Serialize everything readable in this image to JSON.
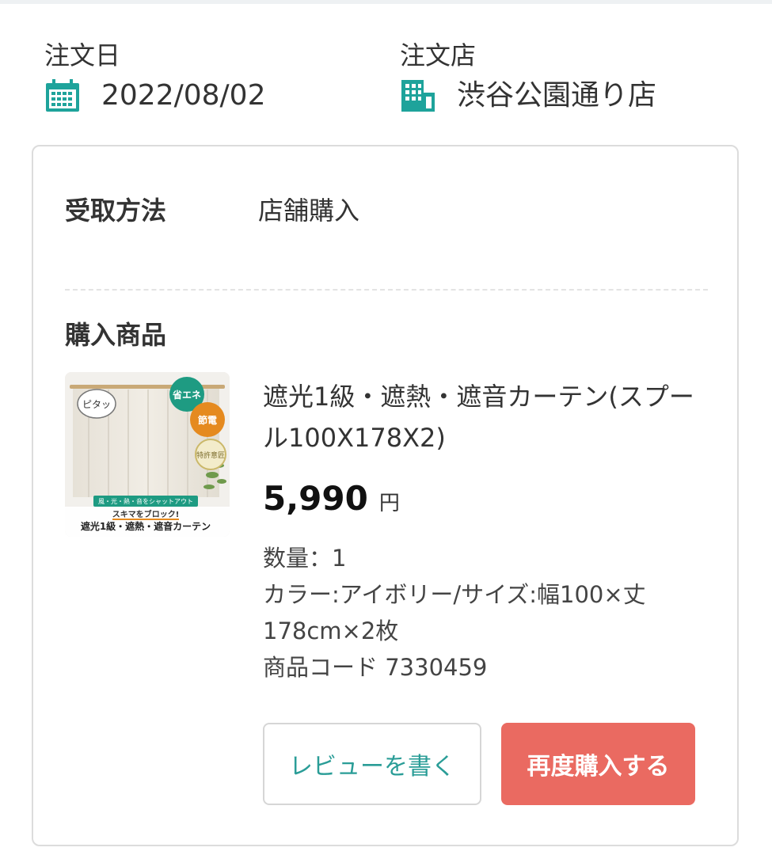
{
  "order_meta": {
    "date_label": "注文日",
    "date_value": "2022/08/02",
    "shop_label": "注文店",
    "shop_value": "渋谷公園通り店"
  },
  "card": {
    "method_label": "受取方法",
    "method_value": "店舗購入",
    "purchased_label": "購入商品",
    "product": {
      "name": "遮光1級・遮熱・遮音カーテン(スプール100X178X2)",
      "price": "5,990",
      "currency": "円",
      "quantity": "数量：1",
      "variant": "カラー:アイボリー/サイズ:幅100×丈178cm×2枚",
      "code": "商品コード 7330459",
      "thumbnail": {
        "badge_pitatto": "ピタッ",
        "badge_energy": "省エネ",
        "badge_power": "節電",
        "badge_patent": "特許意匠",
        "banner_top": "風・光・熱・音をシャットアウト",
        "banner_mid": "スキマをブロック!",
        "banner_bottom": "遮光1級・遮熱・遮音カーテン"
      }
    },
    "buttons": {
      "review": "レビューを書く",
      "rebuy": "再度購入する"
    }
  },
  "colors": {
    "accent_teal": "#2a9d97",
    "rebuy_red": "#ea6a61"
  }
}
